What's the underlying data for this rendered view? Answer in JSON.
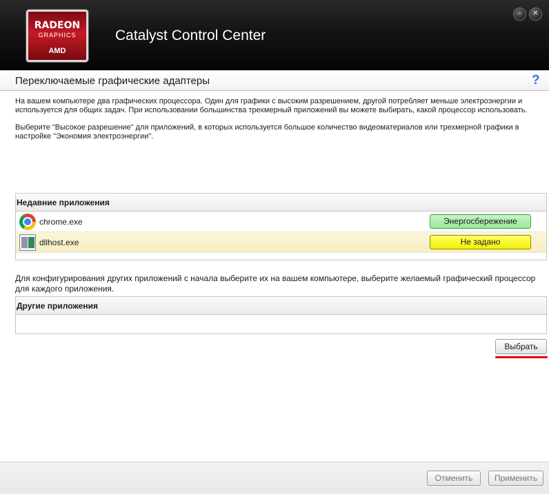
{
  "logo": {
    "line1": "RADEON",
    "line2": "GRAPHICS",
    "line3": "AMD"
  },
  "window": {
    "title": "Catalyst Control Center",
    "minimize_glyph": "–",
    "close_glyph": "✕"
  },
  "section": {
    "title": "Переключаемые графические адаптеры",
    "help_label": "?"
  },
  "text": {
    "intro": "На вашем компьютере два графических процессора. Один для графики с высоким разрешением, другой потребляет меньше электроэнергии и используется для общих задач. При использовании большинства трехмерный приложений вы можете выбирать, какой процессор использовать.",
    "hint": "Выберите \"Высокое разрешение\" для приложений, в которых используется большое количество видеоматериалов или трехмерной графики в настройке \"Экономия электроэнергии\".",
    "other_intro": "Для конфигурирования других приложений с начала выберите их на вашем компьютере, выберите желаемый графический процессор для каждого приложения."
  },
  "recent_apps": {
    "header": "Недавние приложения",
    "rows": [
      {
        "name": "chrome.exe",
        "icon": "chrome-icon",
        "mode": "Энергосбережение",
        "color": "#9be89b"
      },
      {
        "name": "dllhost.exe",
        "icon": "dllhost-icon",
        "mode": "Не задано",
        "color": "#f2f200"
      }
    ]
  },
  "other_apps": {
    "header": "Другие приложения"
  },
  "buttons": {
    "choose": "Выбрать",
    "cancel": "Отменить",
    "apply": "Применить"
  },
  "colors": {
    "titlebar": "#141414",
    "accent_red": "#c41a24",
    "help_blue": "#2b7bd6",
    "underline_red": "#e00000"
  }
}
